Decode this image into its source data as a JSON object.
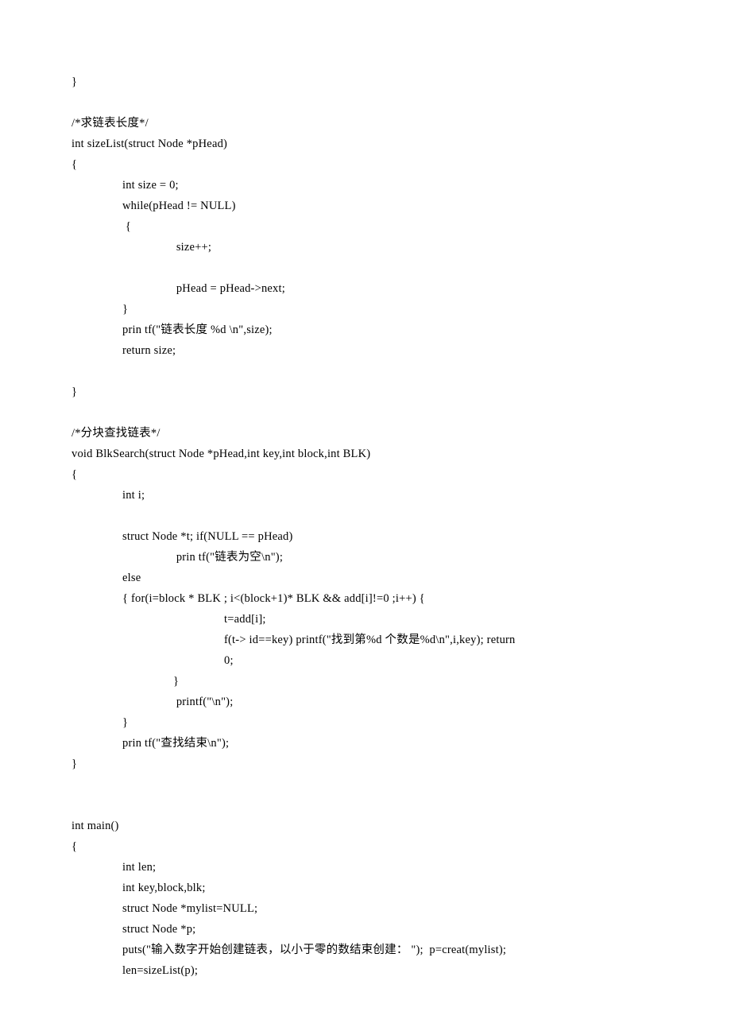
{
  "lines": [
    {
      "cls": "",
      "text": "}"
    },
    {
      "cls": "blank",
      "text": ""
    },
    {
      "cls": "",
      "text": "/*求链表长度*/"
    },
    {
      "cls": "",
      "text": "int sizeList(struct Node *pHead)"
    },
    {
      "cls": "",
      "text": "{"
    },
    {
      "cls": "indent-1",
      "text": "int size = 0;"
    },
    {
      "cls": "indent-1",
      "text": "while(pHead != NULL)"
    },
    {
      "cls": "indent-1",
      "text": " {"
    },
    {
      "cls": "indent-2",
      "text": " size++;"
    },
    {
      "cls": "blank",
      "text": ""
    },
    {
      "cls": "indent-2",
      "text": " pHead = pHead->next;"
    },
    {
      "cls": "indent-1",
      "text": "}"
    },
    {
      "cls": "indent-1",
      "text": "prin tf(\"链表长度 %d \\n\",size);"
    },
    {
      "cls": "indent-1",
      "text": "return size;"
    },
    {
      "cls": "blank",
      "text": ""
    },
    {
      "cls": "",
      "text": "}"
    },
    {
      "cls": "blank",
      "text": ""
    },
    {
      "cls": "",
      "text": "/*分块查找链表*/"
    },
    {
      "cls": "",
      "text": "void BlkSearch(struct Node *pHead,int key,int block,int BLK)"
    },
    {
      "cls": "",
      "text": "{"
    },
    {
      "cls": "indent-1",
      "text": "int i;"
    },
    {
      "cls": "blank",
      "text": ""
    },
    {
      "cls": "indent-1",
      "text": "struct Node *t; if(NULL == pHead)"
    },
    {
      "cls": "indent-2",
      "text": " prin tf(\"链表为空\\n\");"
    },
    {
      "cls": "indent-1",
      "text": "else"
    },
    {
      "cls": "indent-1",
      "text": "{ for(i=block * BLK ; i<(block+1)* BLK && add[i]!=0 ;i++) {"
    },
    {
      "cls": "indent-3",
      "text": "t=add[i];"
    },
    {
      "cls": "indent-3",
      "text": "f(t-> id==key) printf(\"找到第%d 个数是%d\\n\",i,key); return"
    },
    {
      "cls": "indent-3",
      "text": "0;"
    },
    {
      "cls": "indent-2",
      "text": "}"
    },
    {
      "cls": "indent-2",
      "text": " printf(\"\\n\");"
    },
    {
      "cls": "indent-1",
      "text": "}"
    },
    {
      "cls": "indent-1",
      "text": "prin tf(\"查找结束\\n\");"
    },
    {
      "cls": "",
      "text": "}"
    },
    {
      "cls": "blank",
      "text": ""
    },
    {
      "cls": "blank",
      "text": ""
    },
    {
      "cls": "",
      "text": "int main()"
    },
    {
      "cls": "",
      "text": "{"
    },
    {
      "cls": "indent-1",
      "text": "int len;"
    },
    {
      "cls": "indent-1",
      "text": "int key,block,blk;"
    },
    {
      "cls": "indent-1",
      "text": "struct Node *mylist=NULL;"
    },
    {
      "cls": "indent-1",
      "text": "struct Node *p;"
    },
    {
      "cls": "indent-1",
      "text": "puts(\"输入数字开始创建链表，以小于零的数结束创建： \");  p=creat(mylist);"
    },
    {
      "cls": "indent-1",
      "text": "len=sizeList(p);"
    }
  ]
}
